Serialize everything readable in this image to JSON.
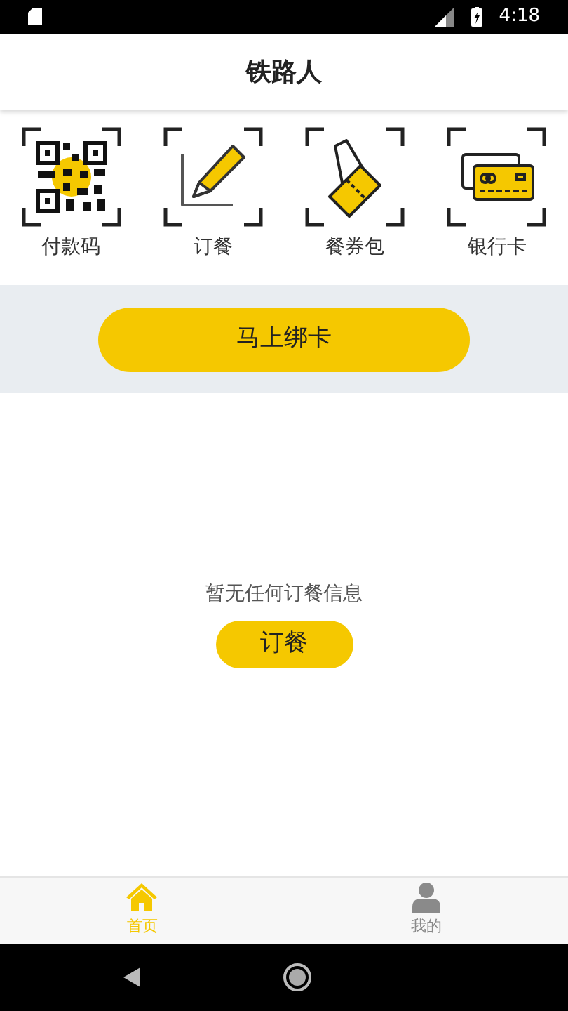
{
  "status_bar": {
    "time": "4:18"
  },
  "header": {
    "title": "铁路人"
  },
  "shortcuts": [
    {
      "kind": "qr",
      "label": "付款码"
    },
    {
      "kind": "order",
      "label": "订餐"
    },
    {
      "kind": "voucher",
      "label": "餐券包"
    },
    {
      "kind": "card",
      "label": "银行卡"
    }
  ],
  "bind_button": "马上绑卡",
  "empty_state": {
    "message": "暂无任何订餐信息",
    "button": "订餐"
  },
  "bottom_tabs": [
    {
      "kind": "home",
      "label": "首页",
      "selected": true
    },
    {
      "kind": "profile",
      "label": "我的",
      "selected": false
    }
  ]
}
